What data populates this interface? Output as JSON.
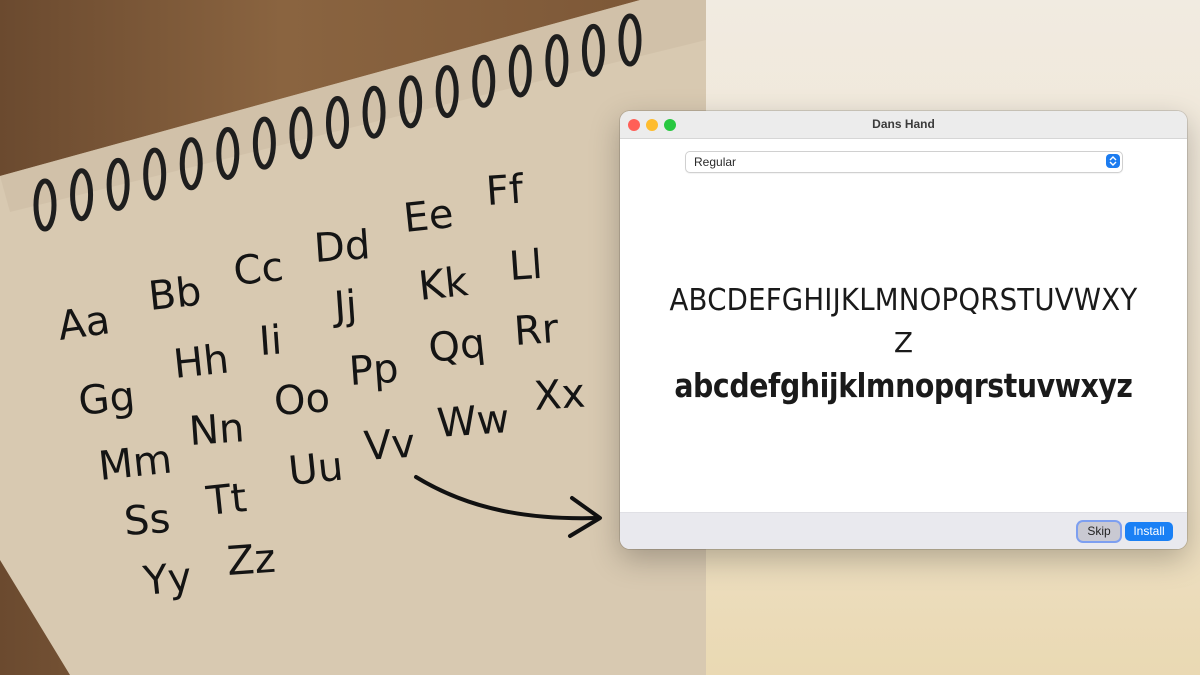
{
  "window": {
    "title": "Dans Hand"
  },
  "style_select": {
    "value": "Regular"
  },
  "preview": {
    "uppercase_line": "ABCDEFGHIJKLMNOPQRSTUVWXY",
    "uppercase_wrap": "Z",
    "lowercase_line": "abcdefghijklmnopqrstuvwxyz"
  },
  "buttons": {
    "skip": "Skip",
    "install": "Install"
  },
  "notebook": {
    "handwritten_pairs": [
      "Aa",
      "Bb",
      "Cc",
      "Dd",
      "Ee",
      "Ff",
      "Gg",
      "Hh",
      "Ii",
      "Jj",
      "Kk",
      "Ll",
      "Mm",
      "Nn",
      "Oo",
      "Pp",
      "Qq",
      "Rr",
      "Ss",
      "Tt",
      "Uu",
      "Vv",
      "Ww",
      "Xx",
      "Yy",
      "Zz"
    ]
  },
  "colors": {
    "accent": "#1a80f5",
    "close": "#ff5f57",
    "minimize": "#febc2e",
    "maximize": "#28c840"
  }
}
